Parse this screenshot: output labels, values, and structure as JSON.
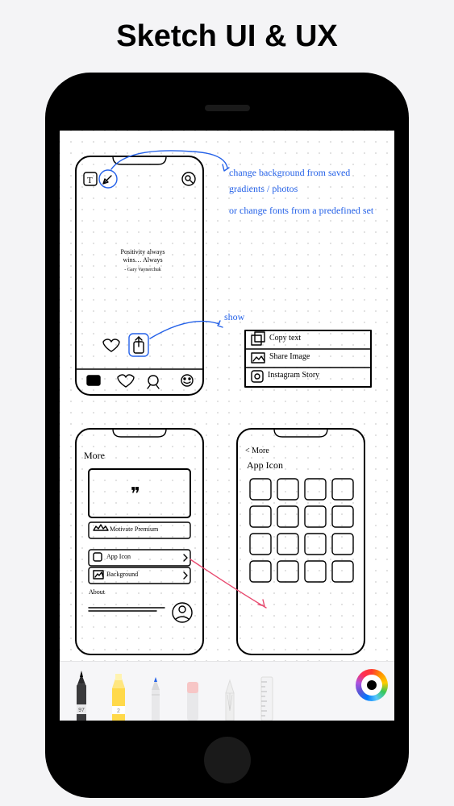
{
  "page": {
    "title": "Sketch UI & UX"
  },
  "annotations": {
    "top1": "change background from saved",
    "top2": "gradients / photos",
    "top3": "or change fonts from a predefined set",
    "show": "show"
  },
  "quote": {
    "line1": "Positivity always",
    "line2": "wins… Always",
    "author": "- Gary Vaynerchuk"
  },
  "menu": {
    "item1": "Copy text",
    "item2": "Share Image",
    "item3": "Instagram Story"
  },
  "screen2": {
    "title": "More",
    "premium": "Motivate Premium",
    "row1": "App Icon",
    "row2": "Background",
    "section": "About"
  },
  "screen3": {
    "back": "< More",
    "title": "App Icon"
  },
  "tools": {
    "pen_label": "97",
    "highlighter_label": "2"
  }
}
